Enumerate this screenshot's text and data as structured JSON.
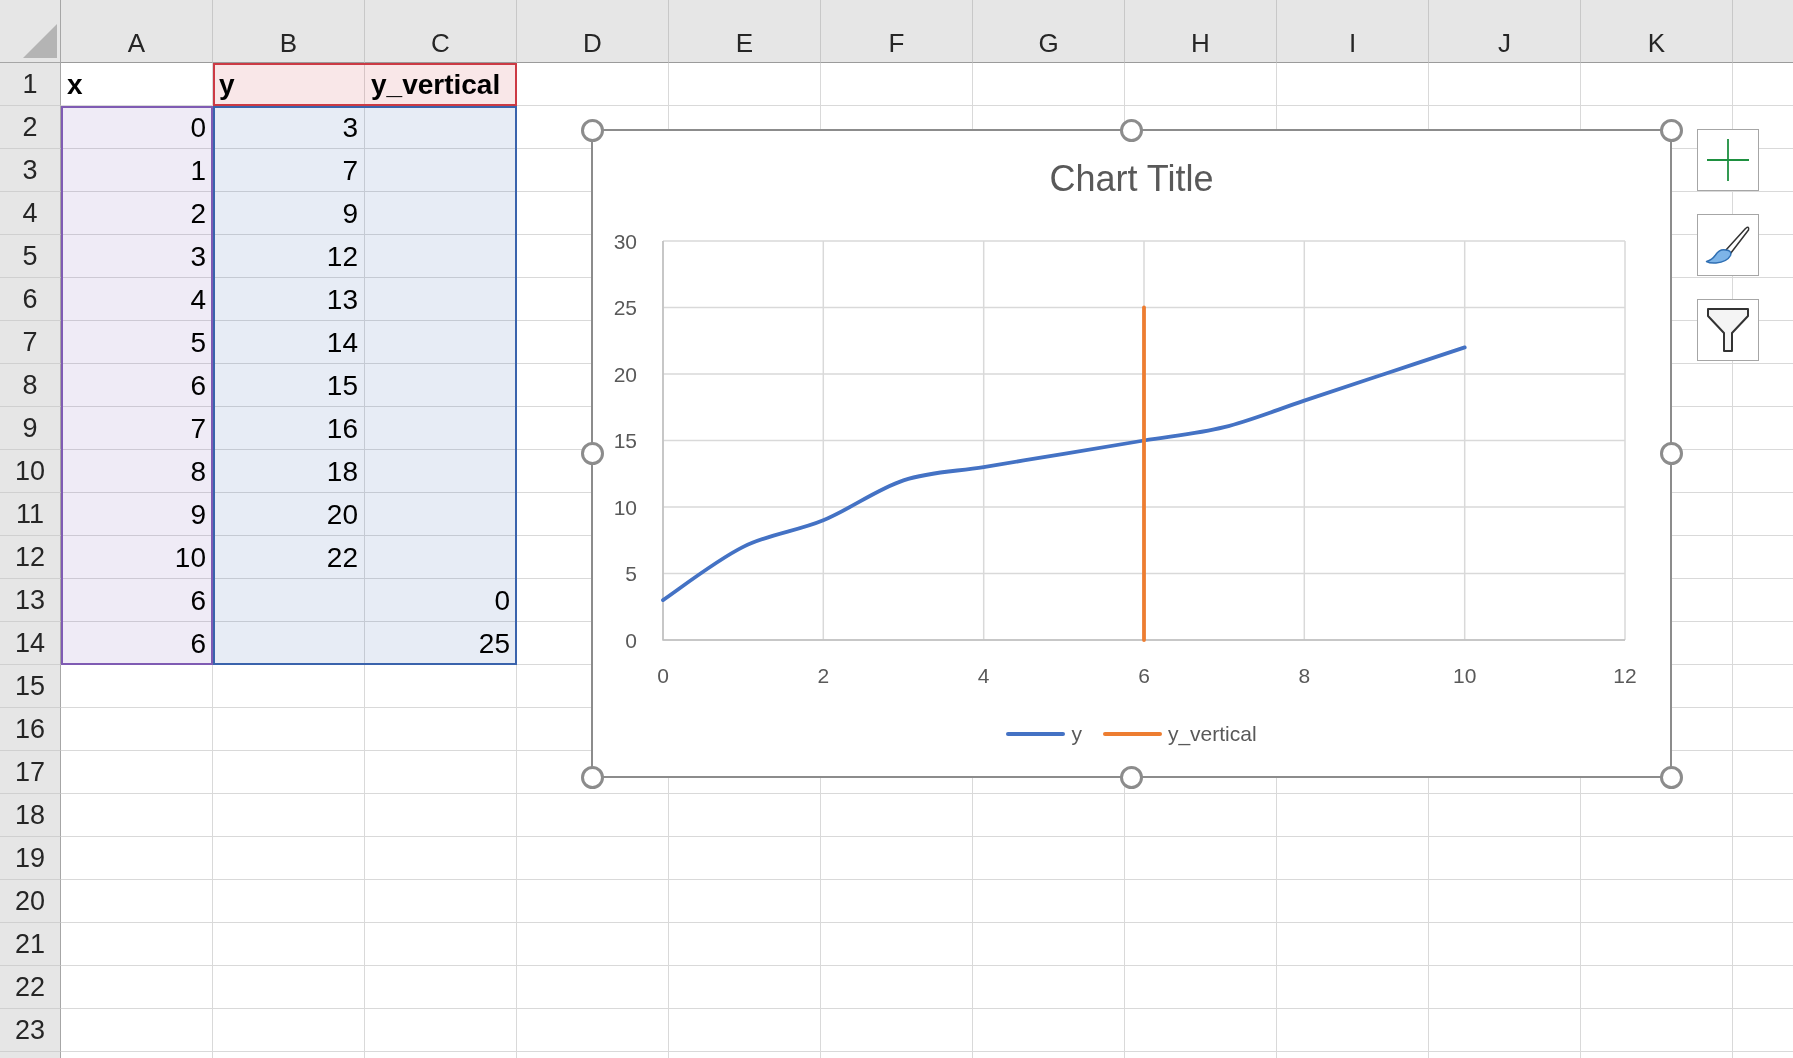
{
  "sheet": {
    "columns": [
      "A",
      "B",
      "C",
      "D",
      "E",
      "F",
      "G",
      "H",
      "I",
      "J",
      "K"
    ],
    "rows": [
      {
        "header": "1",
        "cells": [
          {
            "kind": "label",
            "text": "x"
          },
          {
            "kind": "label",
            "text": "y",
            "color": "#cc3a44"
          },
          {
            "kind": "label",
            "text": "y_vertical",
            "color": "#cc3a44"
          }
        ]
      },
      {
        "header": "2",
        "cells": [
          {
            "kind": "number",
            "text": "0",
            "color": "#7f5bb3"
          },
          {
            "kind": "number",
            "text": "3",
            "color": "#3a63ac"
          },
          {
            "kind": "blank",
            "color": "#3a63ac"
          }
        ]
      },
      {
        "header": "3",
        "cells": [
          {
            "kind": "number",
            "text": "1",
            "color": "#7f5bb3"
          },
          {
            "kind": "number",
            "text": "7",
            "color": "#3a63ac"
          },
          {
            "kind": "blank",
            "color": "#3a63ac"
          }
        ]
      },
      {
        "header": "4",
        "cells": [
          {
            "kind": "number",
            "text": "2",
            "color": "#7f5bb3"
          },
          {
            "kind": "number",
            "text": "9",
            "color": "#3a63ac"
          },
          {
            "kind": "blank",
            "color": "#3a63ac"
          }
        ]
      },
      {
        "header": "5",
        "cells": [
          {
            "kind": "number",
            "text": "3",
            "color": "#7f5bb3"
          },
          {
            "kind": "number",
            "text": "12",
            "color": "#3a63ac"
          },
          {
            "kind": "blank",
            "color": "#3a63ac"
          }
        ]
      },
      {
        "header": "6",
        "cells": [
          {
            "kind": "number",
            "text": "4",
            "color": "#7f5bb3"
          },
          {
            "kind": "number",
            "text": "13",
            "color": "#3a63ac"
          },
          {
            "kind": "blank",
            "color": "#3a63ac"
          }
        ]
      },
      {
        "header": "7",
        "cells": [
          {
            "kind": "number",
            "text": "5",
            "color": "#7f5bb3"
          },
          {
            "kind": "number",
            "text": "14",
            "color": "#3a63ac"
          },
          {
            "kind": "blank",
            "color": "#3a63ac"
          }
        ]
      },
      {
        "header": "8",
        "cells": [
          {
            "kind": "number",
            "text": "6",
            "color": "#7f5bb3"
          },
          {
            "kind": "number",
            "text": "15",
            "color": "#3a63ac"
          },
          {
            "kind": "blank",
            "color": "#3a63ac"
          }
        ]
      },
      {
        "header": "9",
        "cells": [
          {
            "kind": "number",
            "text": "7",
            "color": "#7f5bb3"
          },
          {
            "kind": "number",
            "text": "16",
            "color": "#3a63ac"
          },
          {
            "kind": "blank",
            "color": "#3a63ac"
          }
        ]
      },
      {
        "header": "10",
        "cells": [
          {
            "kind": "number",
            "text": "8",
            "color": "#7f5bb3"
          },
          {
            "kind": "number",
            "text": "18",
            "color": "#3a63ac"
          },
          {
            "kind": "blank",
            "color": "#3a63ac"
          }
        ]
      },
      {
        "header": "11",
        "cells": [
          {
            "kind": "number",
            "text": "9",
            "color": "#7f5bb3"
          },
          {
            "kind": "number",
            "text": "20",
            "color": "#3a63ac"
          },
          {
            "kind": "blank",
            "color": "#3a63ac"
          }
        ]
      },
      {
        "header": "12",
        "cells": [
          {
            "kind": "number",
            "text": "10",
            "color": "#7f5bb3"
          },
          {
            "kind": "number",
            "text": "22",
            "color": "#3a63ac"
          },
          {
            "kind": "blank",
            "color": "#3a63ac"
          }
        ]
      },
      {
        "header": "13",
        "cells": [
          {
            "kind": "number",
            "text": "6",
            "color": "#7f5bb3"
          },
          {
            "kind": "blank",
            "color": "#3a63ac"
          },
          {
            "kind": "number",
            "text": "0",
            "color": "#3a63ac"
          }
        ]
      },
      {
        "header": "14",
        "cells": [
          {
            "kind": "number",
            "text": "6",
            "color": "#7f5bb3"
          },
          {
            "kind": "blank",
            "color": "#3a63ac"
          },
          {
            "kind": "number",
            "text": "25",
            "color": "#3a63ac"
          }
        ]
      },
      {
        "header": "15"
      },
      {
        "header": "16"
      },
      {
        "header": "17"
      },
      {
        "header": "18"
      },
      {
        "header": "19"
      },
      {
        "header": "20"
      },
      {
        "header": "21"
      },
      {
        "header": "22"
      },
      {
        "header": "23"
      }
    ]
  },
  "chart": {
    "selected": true,
    "chart_data": {
      "type": "line",
      "title": "Chart Title",
      "series": [
        {
          "name": "y",
          "color": "#4472c4",
          "x": [
            0,
            1,
            2,
            3,
            4,
            5,
            6,
            7,
            8,
            9,
            10
          ],
          "values": [
            3,
            7,
            9,
            12,
            13,
            14,
            15,
            16,
            18,
            20,
            22
          ]
        },
        {
          "name": "y_vertical",
          "color": "#ed7d31",
          "x": [
            6,
            6
          ],
          "values": [
            0,
            25
          ]
        }
      ],
      "xlim": [
        0,
        12
      ],
      "ylim": [
        0,
        30
      ],
      "xticks": [
        0,
        2,
        4,
        6,
        8,
        10,
        12
      ],
      "yticks": [
        0,
        5,
        10,
        15,
        20,
        25,
        30
      ],
      "grid": true,
      "legend": "bottom"
    }
  }
}
